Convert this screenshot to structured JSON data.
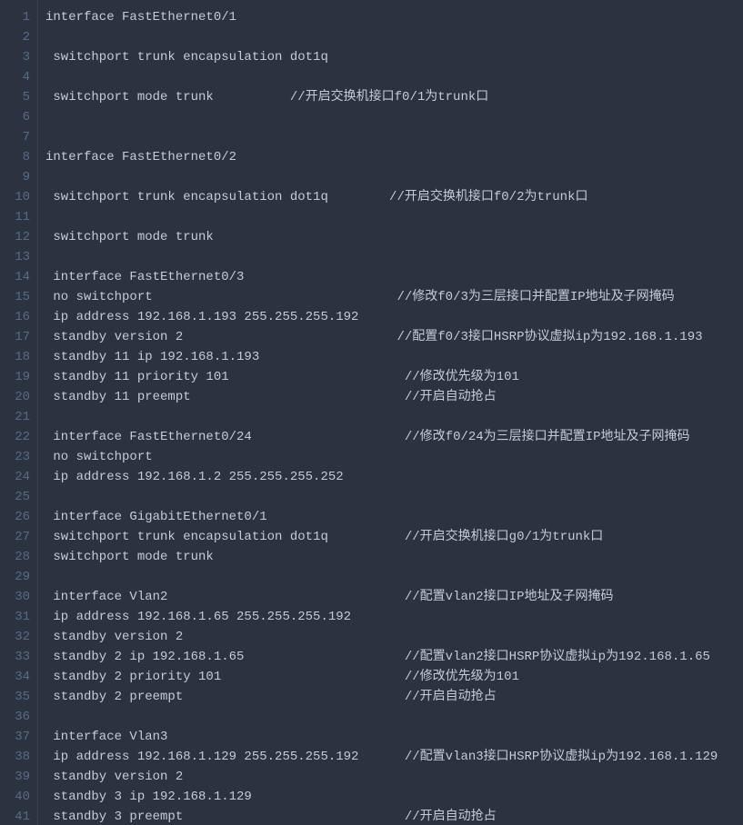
{
  "lines": [
    {
      "n": 1,
      "text": "interface FastEthernet0/1",
      "comment": ""
    },
    {
      "n": 2,
      "text": "",
      "comment": ""
    },
    {
      "n": 3,
      "text": " switchport trunk encapsulation dot1q",
      "comment": ""
    },
    {
      "n": 4,
      "text": "",
      "comment": ""
    },
    {
      "n": 5,
      "text": " switchport mode trunk          //开启交换机接口f0/1为trunk口",
      "comment": ""
    },
    {
      "n": 6,
      "text": "",
      "comment": ""
    },
    {
      "n": 7,
      "text": "",
      "comment": ""
    },
    {
      "n": 8,
      "text": "interface FastEthernet0/2",
      "comment": ""
    },
    {
      "n": 9,
      "text": "",
      "comment": ""
    },
    {
      "n": 10,
      "text": " switchport trunk encapsulation dot1q        //开启交换机接口f0/2为trunk口",
      "comment": ""
    },
    {
      "n": 11,
      "text": "",
      "comment": ""
    },
    {
      "n": 12,
      "text": " switchport mode trunk",
      "comment": ""
    },
    {
      "n": 13,
      "text": "",
      "comment": ""
    },
    {
      "n": 14,
      "text": " interface FastEthernet0/3",
      "comment": ""
    },
    {
      "n": 15,
      "text": " no switchport                                //修改f0/3为三层接口并配置IP地址及子网掩码",
      "comment": ""
    },
    {
      "n": 16,
      "text": " ip address 192.168.1.193 255.255.255.192",
      "comment": ""
    },
    {
      "n": 17,
      "text": " standby version 2                            //配置f0/3接口HSRP协议虚拟ip为192.168.1.193",
      "comment": ""
    },
    {
      "n": 18,
      "text": " standby 11 ip 192.168.1.193",
      "comment": ""
    },
    {
      "n": 19,
      "text": " standby 11 priority 101                       //修改优先级为101",
      "comment": ""
    },
    {
      "n": 20,
      "text": " standby 11 preempt                            //开启自动抢占",
      "comment": ""
    },
    {
      "n": 21,
      "text": "",
      "comment": ""
    },
    {
      "n": 22,
      "text": " interface FastEthernet0/24                    //修改f0/24为三层接口并配置IP地址及子网掩码",
      "comment": ""
    },
    {
      "n": 23,
      "text": " no switchport",
      "comment": ""
    },
    {
      "n": 24,
      "text": " ip address 192.168.1.2 255.255.255.252",
      "comment": ""
    },
    {
      "n": 25,
      "text": "",
      "comment": ""
    },
    {
      "n": 26,
      "text": " interface GigabitEthernet0/1",
      "comment": ""
    },
    {
      "n": 27,
      "text": " switchport trunk encapsulation dot1q          //开启交换机接口g0/1为trunk口",
      "comment": ""
    },
    {
      "n": 28,
      "text": " switchport mode trunk",
      "comment": ""
    },
    {
      "n": 29,
      "text": "",
      "comment": ""
    },
    {
      "n": 30,
      "text": " interface Vlan2                               //配置vlan2接口IP地址及子网掩码",
      "comment": ""
    },
    {
      "n": 31,
      "text": " ip address 192.168.1.65 255.255.255.192",
      "comment": ""
    },
    {
      "n": 32,
      "text": " standby version 2",
      "comment": ""
    },
    {
      "n": 33,
      "text": " standby 2 ip 192.168.1.65                     //配置vlan2接口HSRP协议虚拟ip为192.168.1.65",
      "comment": ""
    },
    {
      "n": 34,
      "text": " standby 2 priority 101                        //修改优先级为101",
      "comment": ""
    },
    {
      "n": 35,
      "text": " standby 2 preempt                             //开启自动抢占",
      "comment": ""
    },
    {
      "n": 36,
      "text": "",
      "comment": ""
    },
    {
      "n": 37,
      "text": " interface Vlan3",
      "comment": ""
    },
    {
      "n": 38,
      "text": " ip address 192.168.1.129 255.255.255.192      //配置vlan3接口HSRP协议虚拟ip为192.168.1.129",
      "comment": ""
    },
    {
      "n": 39,
      "text": " standby version 2",
      "comment": ""
    },
    {
      "n": 40,
      "text": " standby 3 ip 192.168.1.129",
      "comment": ""
    },
    {
      "n": 41,
      "text": " standby 3 preempt                             //开启自动抢占",
      "comment": ""
    }
  ]
}
